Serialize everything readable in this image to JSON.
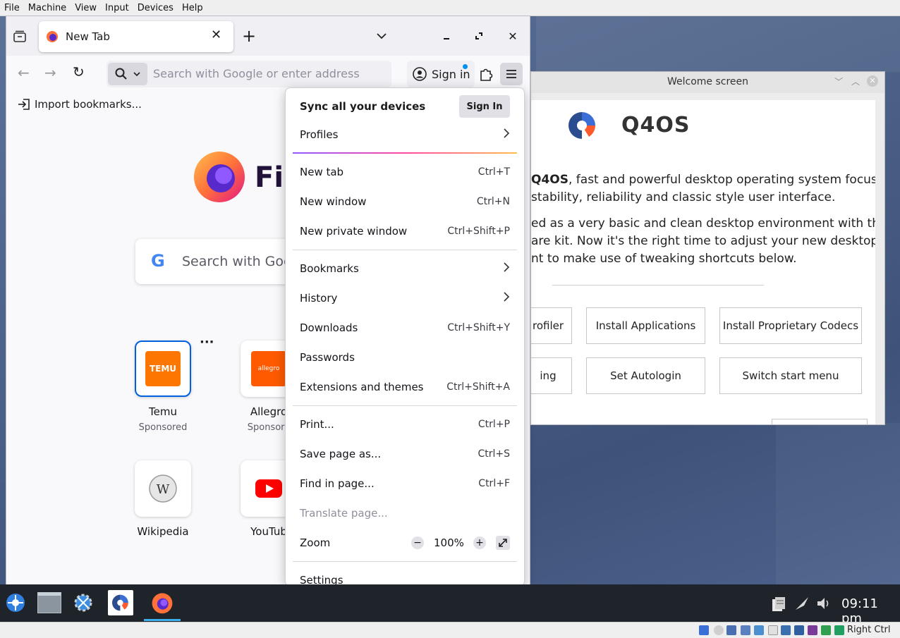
{
  "vbox_menu": [
    "File",
    "Machine",
    "View",
    "Input",
    "Devices",
    "Help"
  ],
  "firefox": {
    "tab_title": "New Tab",
    "url_placeholder": "Search with Google or enter address",
    "sign_in_label": "Sign in",
    "import_bookmarks": "Import bookmarks...",
    "logo_text": "Fir",
    "search_placeholder": "Search with Goo",
    "shortcuts": [
      {
        "label": "Temu",
        "sub": "Sponsored",
        "icon": "temu-icon",
        "icon_text": "TEMU"
      },
      {
        "label": "Allegro",
        "sub": "Sponsore",
        "icon": "allegro-icon",
        "icon_text": "allegro"
      },
      {
        "label": "Wikipedia",
        "sub": "",
        "icon": "wikipedia-icon"
      },
      {
        "label": "YouTub",
        "sub": "",
        "icon": "youtube-icon"
      }
    ]
  },
  "menu": {
    "sync_title": "Sync all your devices",
    "sign_in_button": "Sign In",
    "profiles": "Profiles",
    "items1": [
      {
        "label": "New tab",
        "shortcut": "Ctrl+T"
      },
      {
        "label": "New window",
        "shortcut": "Ctrl+N"
      },
      {
        "label": "New private window",
        "shortcut": "Ctrl+Shift+P"
      }
    ],
    "items2": [
      {
        "label": "Bookmarks",
        "shortcut": ""
      },
      {
        "label": "History",
        "shortcut": ""
      },
      {
        "label": "Downloads",
        "shortcut": "Ctrl+Shift+Y"
      },
      {
        "label": "Passwords",
        "shortcut": ""
      },
      {
        "label": "Extensions and themes",
        "shortcut": "Ctrl+Shift+A"
      }
    ],
    "items3": [
      {
        "label": "Print...",
        "shortcut": "Ctrl+P"
      },
      {
        "label": "Save page as...",
        "shortcut": "Ctrl+S"
      },
      {
        "label": "Find in page...",
        "shortcut": "Ctrl+F"
      },
      {
        "label": "Translate page...",
        "shortcut": ""
      }
    ],
    "zoom_label": "Zoom",
    "zoom_value": "100%",
    "settings": "Settings"
  },
  "welcome": {
    "title": "Welcome screen",
    "brand": "Q4OS",
    "para1_line1_bold": "Q4OS",
    "para1_line1_rest": ", fast and powerful desktop operating system focused",
    "para1_line2": "stability, reliability and classic style user interface.",
    "para2_line1": "ed as a very basic and clean desktop environment with the",
    "para2_line2": "are kit. Now it's the right time to adjust your new desktop,",
    "para2_line3": "nt to make use of tweaking shortcuts below.",
    "buttons": [
      "rofiler",
      "Install Applications",
      "Install Proprietary Codecs",
      "ing",
      "Set Autologin",
      "Switch start menu"
    ]
  },
  "taskbar": {
    "clock": "09:11 pm"
  },
  "statusbar": {
    "host_key": "Right Ctrl"
  },
  "colors": {
    "accent": "#0061e0",
    "temu": "#fb7701",
    "allegro": "#ff5a00",
    "youtube": "#ff0000"
  }
}
